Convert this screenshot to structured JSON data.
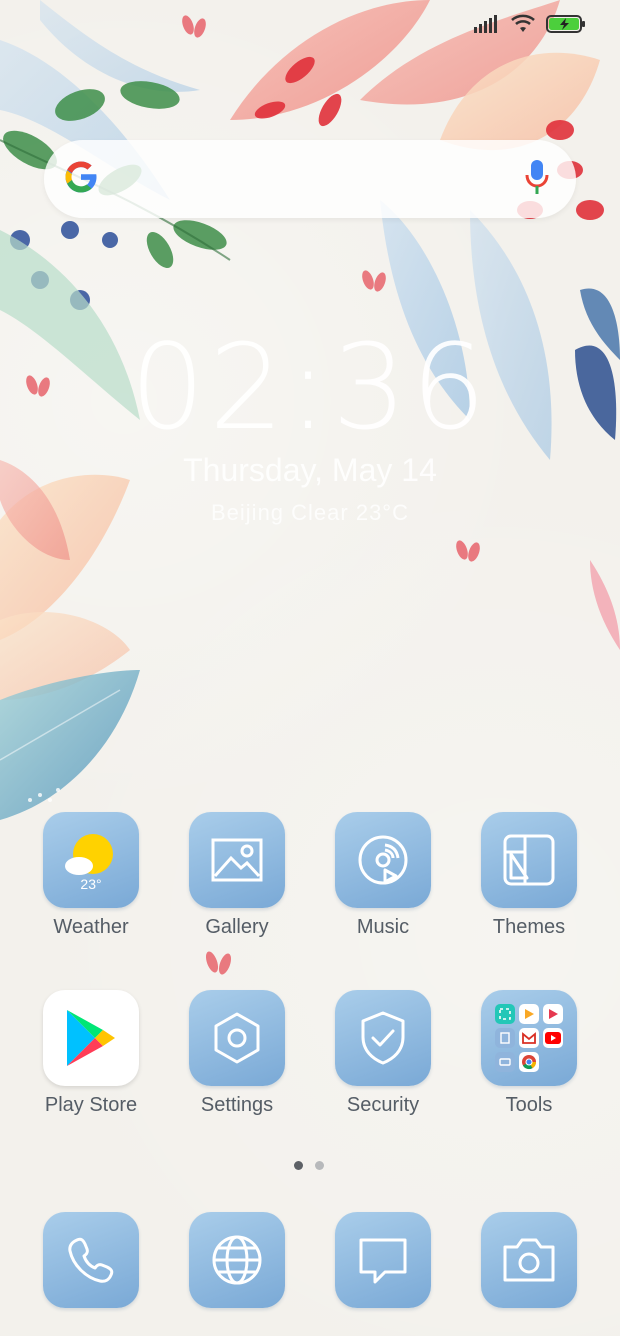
{
  "search": {
    "logo_icon": "google-g-icon",
    "mic_icon": "google-mic-icon"
  },
  "status": {
    "signal_icon": "cellular-signal-icon",
    "wifi_icon": "wifi-icon",
    "battery_icon": "battery-charging-icon"
  },
  "clock": {
    "time": "02:36",
    "date": "Thursday, May 14",
    "weather": "Beijing  Clear  23°C"
  },
  "apps": [
    {
      "label": "Weather",
      "icon": "weather-sun-cloud-icon",
      "temp": "23°"
    },
    {
      "label": "Gallery",
      "icon": "gallery-image-icon"
    },
    {
      "label": "Music",
      "icon": "music-disc-icon"
    },
    {
      "label": "Themes",
      "icon": "themes-icon"
    },
    {
      "label": "Play Store",
      "icon": "play-store-icon"
    },
    {
      "label": "Settings",
      "icon": "settings-hexagon-icon"
    },
    {
      "label": "Security",
      "icon": "security-shield-icon"
    },
    {
      "label": "Tools",
      "icon": "tools-folder-icon"
    }
  ],
  "dock": [
    {
      "name": "phone",
      "icon": "phone-icon"
    },
    {
      "name": "browser",
      "icon": "globe-icon"
    },
    {
      "name": "messages",
      "icon": "message-icon"
    },
    {
      "name": "camera",
      "icon": "camera-icon"
    }
  ],
  "pages": {
    "count": 2,
    "current": 1
  },
  "colors": {
    "icon_blue_top": "#a9cdea",
    "icon_blue_bottom": "#7aa9d6",
    "label": "#555d66"
  }
}
